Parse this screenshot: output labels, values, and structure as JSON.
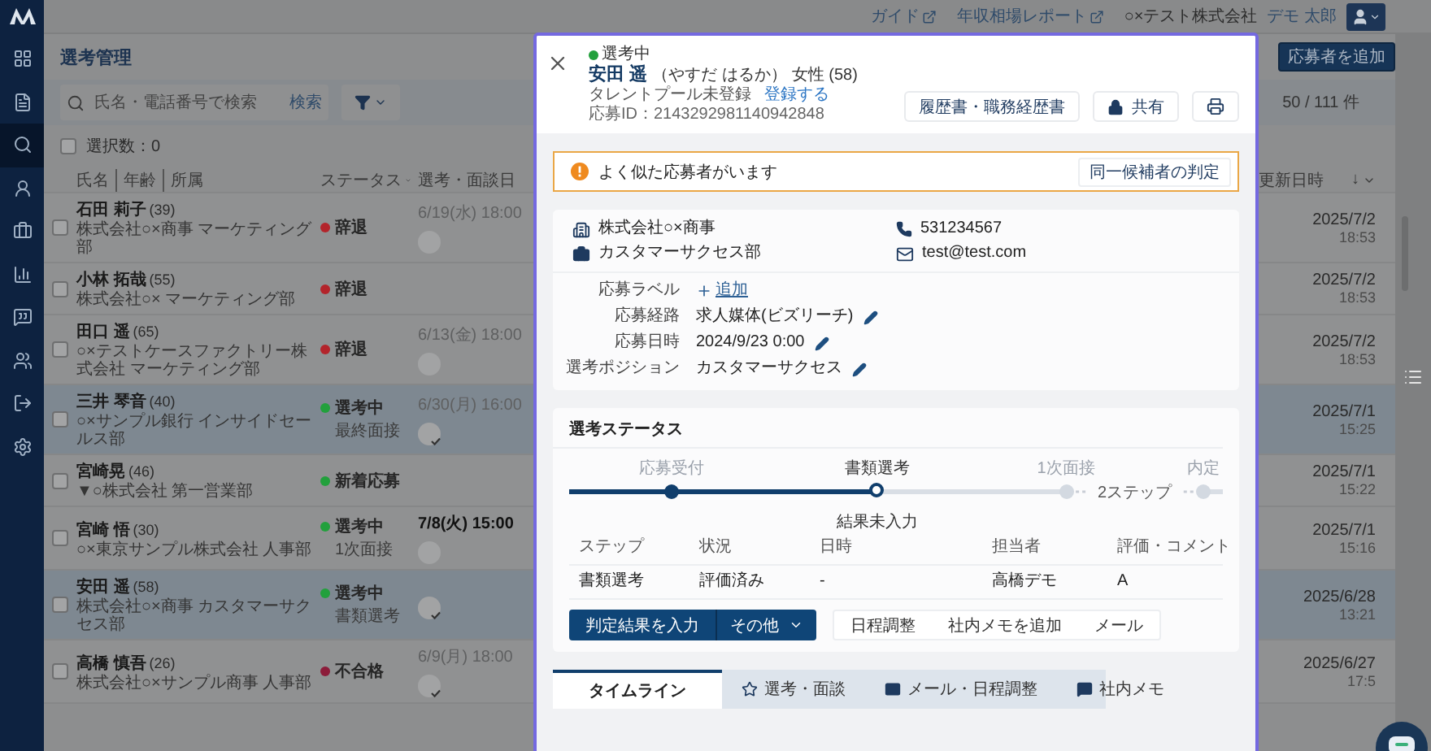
{
  "sidebar": {
    "items": [
      {
        "selected": false
      },
      {
        "selected": false
      },
      {
        "selected": true
      },
      {
        "selected": false
      },
      {
        "selected": false
      },
      {
        "selected": false
      },
      {
        "selected": false
      },
      {
        "selected": false
      },
      {
        "selected": false
      },
      {
        "selected": false
      }
    ]
  },
  "topbar": {
    "links": [
      "ガイド",
      "年収相場レポート"
    ],
    "company": "○×テスト株式会社",
    "user": "デモ 太郎"
  },
  "page": {
    "title": "選考管理",
    "add_button": "応募者を追加",
    "search": {
      "placeholder": "氏名・電話番号で検索",
      "button": "検索"
    },
    "count": "50 / 111 件",
    "selection": "選択数：0",
    "select_all_checked": false,
    "columns": {
      "name_parts": [
        "氏名",
        "年齢",
        "所属"
      ],
      "status": "ステータス",
      "date": "選考・面談日",
      "updated": "更新日時",
      "sort": "↓"
    },
    "rows": [
      {
        "name": "石田 莉子",
        "age": "(39)",
        "company": "株式会社○×商事 マーケティング部",
        "status": "辞退",
        "color": "#b3242b",
        "date": "6/19(水) 18:00",
        "upcoming": false,
        "avatar": true,
        "avatar_checked": false,
        "checked": false,
        "highlighted": false,
        "updated_date": "2025/7/2",
        "updated_time": "18:53"
      },
      {
        "name": "小林 拓哉",
        "age": "(55)",
        "company": "株式会社○× マーケティング部",
        "status": "辞退",
        "color": "#b3242b",
        "checked": false,
        "highlighted": false,
        "updated_date": "2025/7/2",
        "updated_time": "18:53"
      },
      {
        "name": "田口 遥",
        "age": "(65)",
        "company": "○×テストケースファクトリー株式会社 マーケティング部",
        "status": "辞退",
        "color": "#b3242b",
        "date": "6/13(金) 18:00",
        "upcoming": false,
        "avatar": true,
        "avatar_checked": false,
        "checked": false,
        "highlighted": false,
        "updated_date": "2025/7/2",
        "updated_time": "18:53"
      },
      {
        "name": "三井 琴音",
        "age": "(40)",
        "company": "○×サンプル銀行 インサイドセールス部",
        "status": "選考中",
        "color": "#22a03c",
        "sub_status": "最終面接",
        "date": "6/30(月) 16:00",
        "upcoming": false,
        "avatar": true,
        "avatar_checked": true,
        "checked": false,
        "highlighted": true,
        "updated_date": "2025/7/1",
        "updated_time": "15:25"
      },
      {
        "name": "宮崎晃",
        "age": "(46)",
        "company": "▼○株式会社 第一営業部",
        "status": "新着応募",
        "color": "#22a03c",
        "checked": false,
        "highlighted": false,
        "updated_date": "2025/7/1",
        "updated_time": "15:22"
      },
      {
        "name": "宮崎 悟",
        "age": "(30)",
        "company": "○×東京サンプル株式会社 人事部",
        "status": "選考中",
        "color": "#22a03c",
        "sub_status": "1次面接",
        "date": "7/8(火) 15:00",
        "upcoming": true,
        "avatar": true,
        "avatar_checked": false,
        "checked": false,
        "highlighted": false,
        "updated_date": "2025/7/1",
        "updated_time": "15:16"
      },
      {
        "name": "安田 遥",
        "age": "(58)",
        "company": "株式会社○×商事 カスタマーサクセス部",
        "status": "選考中",
        "color": "#22a03c",
        "sub_status": "書類選考",
        "avatar": true,
        "avatar_checked": true,
        "checked": false,
        "highlighted": true,
        "updated_date": "2025/6/28",
        "updated_time": "13:21"
      },
      {
        "name": "高橋 慎吾",
        "age": "(26)",
        "company": "株式会社○×サンプル商事 人事部",
        "status": "不合格",
        "color": "#8c1c3a",
        "date": "6/9(月) 18:00",
        "upcoming": false,
        "avatar": true,
        "avatar_checked": true,
        "checked": false,
        "highlighted": false,
        "updated_date": "2025/6/27",
        "updated_time": "17:5"
      }
    ]
  },
  "modal": {
    "status": {
      "label": "選考中",
      "color": "#22a03c"
    },
    "name": "安田 遥",
    "kana": "（やすだ はるか）",
    "gender_age": "女性 (58)",
    "talent_pool": "タレントプール未登録",
    "register_link": "登録する",
    "application_id": "応募ID：2143292981140942848",
    "actions": [
      "履歴書・職務経歴書",
      "共有"
    ],
    "alert": {
      "message": "よく似た応募者がいます",
      "button": "同一候補者の判定"
    },
    "contact": {
      "company": "株式会社○×商事",
      "phone": "531234567",
      "department": "カスタマーサクセス部",
      "email": "test@test.com"
    },
    "details": [
      {
        "label": "応募ラベル",
        "value": "追加",
        "kind": "add"
      },
      {
        "label": "応募経路",
        "value": "求人媒体(ビズリーチ)",
        "kind": "editable"
      },
      {
        "label": "応募日時",
        "value": "2024/9/23 0:00",
        "kind": "editable"
      },
      {
        "label": "選考ポジション",
        "value": "カスタマーサクセス",
        "kind": "editable"
      }
    ],
    "selection": {
      "title": "選考ステータス",
      "steps": [
        {
          "label": "応募受付",
          "completed": true,
          "current": false
        },
        {
          "label": "書類選考",
          "completed": false,
          "current": true
        },
        {
          "label": "1次面接",
          "completed": false,
          "current": false
        },
        {
          "label": "内定",
          "completed": false,
          "current": false
        }
      ],
      "skipped": "2ステップ",
      "result": "結果未入力",
      "table": {
        "columns": [
          "ステップ",
          "状況",
          "日時",
          "担当者",
          "評価・コメント"
        ],
        "rows": [
          [
            "書類選考",
            "評価済み",
            "-",
            "高橋デモ",
            "A"
          ]
        ]
      },
      "primary_button": "判定結果を入力",
      "more_button": "その他",
      "actions": [
        "日程調整",
        "社内メモを追加",
        "メール"
      ]
    },
    "tabs": [
      {
        "label": "タイムライン",
        "selected": true
      },
      {
        "label": "選考・面談",
        "selected": false
      },
      {
        "label": "メール・日程調整",
        "selected": false
      },
      {
        "label": "社内メモ",
        "selected": false
      }
    ]
  }
}
